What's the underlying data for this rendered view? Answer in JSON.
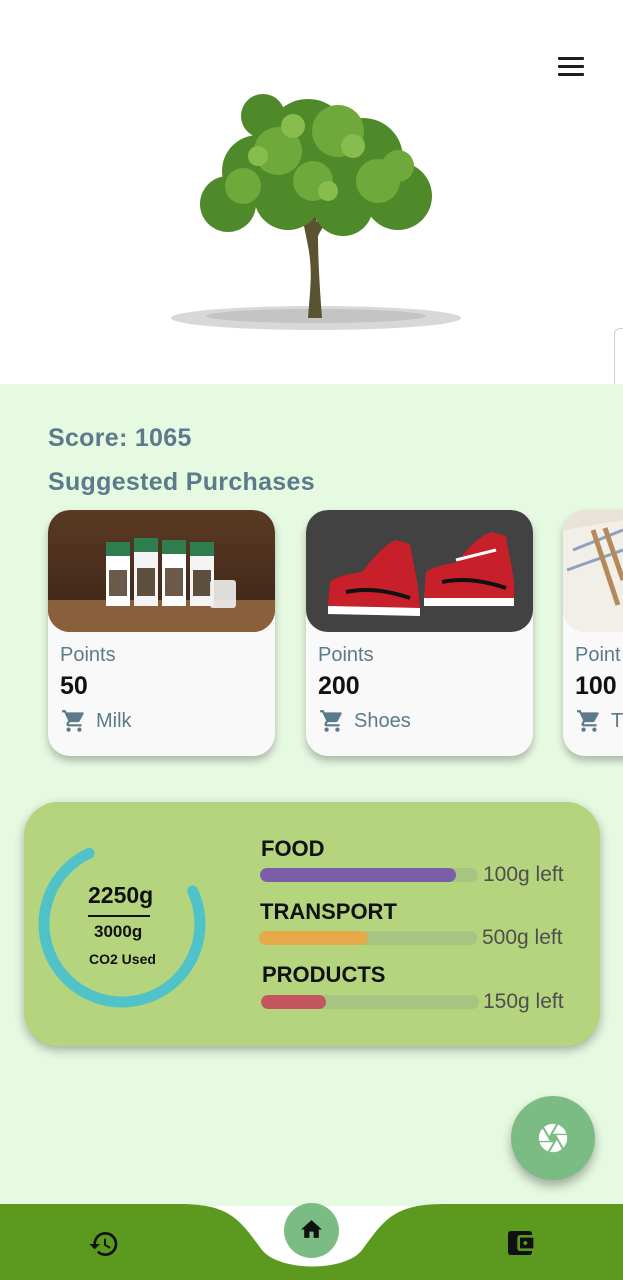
{
  "header": {
    "menu_icon": "menu-icon",
    "image": "tree-illustration"
  },
  "score": {
    "text": "Score: 1065"
  },
  "suggested": {
    "title": "Suggested Purchases",
    "items": [
      {
        "points_label": "Points",
        "points": "50",
        "name": "Milk",
        "icon": "cart-icon"
      },
      {
        "points_label": "Points",
        "points": "200",
        "name": "Shoes",
        "icon": "cart-icon"
      },
      {
        "points_label": "Point",
        "points": "100",
        "name": "T",
        "icon": "cart-icon"
      }
    ]
  },
  "co2": {
    "used": "2250g",
    "total": "3000g",
    "caption": "CO2 Used",
    "used_fraction": 0.75,
    "ring_color": "#4fc3c8",
    "categories": [
      {
        "label": "FOOD",
        "remaining": "100g left",
        "fraction": 0.9,
        "color": "#7b5ea7"
      },
      {
        "label": "TRANSPORT",
        "remaining": "500g left",
        "fraction": 0.5,
        "color": "#e8a94a"
      },
      {
        "label": "PRODUCTS",
        "remaining": "150g left",
        "fraction": 0.3,
        "color": "#c4565f"
      }
    ]
  },
  "fab": {
    "icon": "camera-shutter-icon"
  },
  "nav": {
    "history_icon": "history-icon",
    "home_icon": "home-icon",
    "wallet_icon": "wallet-icon",
    "color": "#5c9a1f"
  }
}
